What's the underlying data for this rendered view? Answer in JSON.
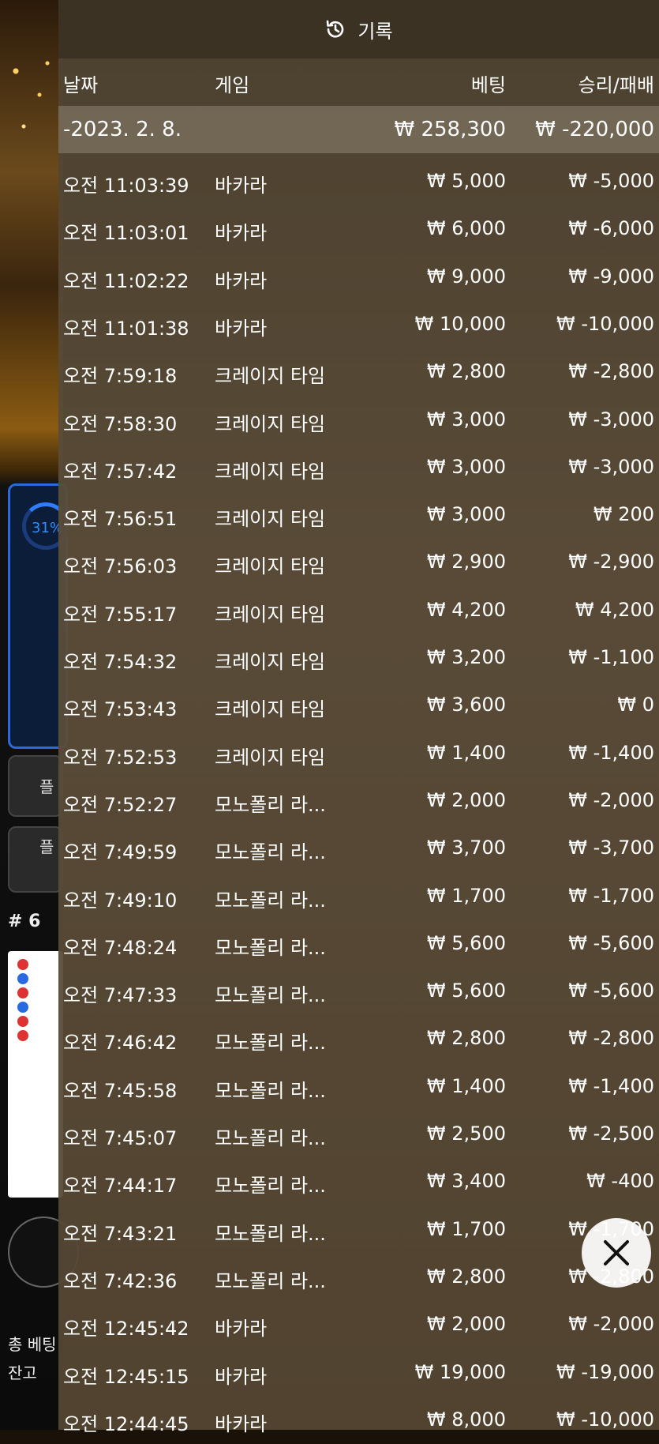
{
  "title": "기록",
  "columns": {
    "date": "날짜",
    "game": "게임",
    "bet": "베팅",
    "winloss": "승리/패배"
  },
  "date_group": {
    "date": "-2023. 2. 8.",
    "bet": "₩ 258,300",
    "winloss": "₩ -220,000"
  },
  "rows": [
    {
      "time": "오전 11:03:39",
      "game": "바카라",
      "bet": "₩ 5,000",
      "winloss": "₩ -5,000"
    },
    {
      "time": "오전 11:03:01",
      "game": "바카라",
      "bet": "₩ 6,000",
      "winloss": "₩ -6,000"
    },
    {
      "time": "오전 11:02:22",
      "game": "바카라",
      "bet": "₩ 9,000",
      "winloss": "₩ -9,000"
    },
    {
      "time": "오전 11:01:38",
      "game": "바카라",
      "bet": "₩ 10,000",
      "winloss": "₩ -10,000"
    },
    {
      "time": "오전 7:59:18",
      "game": "크레이지 타임",
      "bet": "₩ 2,800",
      "winloss": "₩ -2,800"
    },
    {
      "time": "오전 7:58:30",
      "game": "크레이지 타임",
      "bet": "₩ 3,000",
      "winloss": "₩ -3,000"
    },
    {
      "time": "오전 7:57:42",
      "game": "크레이지 타임",
      "bet": "₩ 3,000",
      "winloss": "₩ -3,000"
    },
    {
      "time": "오전 7:56:51",
      "game": "크레이지 타임",
      "bet": "₩ 3,000",
      "winloss": "₩ 200"
    },
    {
      "time": "오전 7:56:03",
      "game": "크레이지 타임",
      "bet": "₩ 2,900",
      "winloss": "₩ -2,900"
    },
    {
      "time": "오전 7:55:17",
      "game": "크레이지 타임",
      "bet": "₩ 4,200",
      "winloss": "₩ 4,200"
    },
    {
      "time": "오전 7:54:32",
      "game": "크레이지 타임",
      "bet": "₩ 3,200",
      "winloss": "₩ -1,100"
    },
    {
      "time": "오전 7:53:43",
      "game": "크레이지 타임",
      "bet": "₩ 3,600",
      "winloss": "₩ 0"
    },
    {
      "time": "오전 7:52:53",
      "game": "크레이지 타임",
      "bet": "₩ 1,400",
      "winloss": "₩ -1,400"
    },
    {
      "time": "오전 7:52:27",
      "game": "모노폴리 라...",
      "bet": "₩ 2,000",
      "winloss": "₩ -2,000"
    },
    {
      "time": "오전 7:49:59",
      "game": "모노폴리 라...",
      "bet": "₩ 3,700",
      "winloss": "₩ -3,700"
    },
    {
      "time": "오전 7:49:10",
      "game": "모노폴리 라...",
      "bet": "₩ 1,700",
      "winloss": "₩ -1,700"
    },
    {
      "time": "오전 7:48:24",
      "game": "모노폴리 라...",
      "bet": "₩ 5,600",
      "winloss": "₩ -5,600"
    },
    {
      "time": "오전 7:47:33",
      "game": "모노폴리 라...",
      "bet": "₩ 5,600",
      "winloss": "₩ -5,600"
    },
    {
      "time": "오전 7:46:42",
      "game": "모노폴리 라...",
      "bet": "₩ 2,800",
      "winloss": "₩ -2,800"
    },
    {
      "time": "오전 7:45:58",
      "game": "모노폴리 라...",
      "bet": "₩ 1,400",
      "winloss": "₩ -1,400"
    },
    {
      "time": "오전 7:45:07",
      "game": "모노폴리 라...",
      "bet": "₩ 2,500",
      "winloss": "₩ -2,500"
    },
    {
      "time": "오전 7:44:17",
      "game": "모노폴리 라...",
      "bet": "₩ 3,400",
      "winloss": "₩ -400"
    },
    {
      "time": "오전 7:43:21",
      "game": "모노폴리 라...",
      "bet": "₩ 1,700",
      "winloss": "₩ -1,700"
    },
    {
      "time": "오전 7:42:36",
      "game": "모노폴리 라...",
      "bet": "₩ 2,800",
      "winloss": "₩ -2,800"
    },
    {
      "time": "오전 12:45:42",
      "game": "바카라",
      "bet": "₩ 2,000",
      "winloss": "₩ -2,000"
    },
    {
      "time": "오전 12:45:15",
      "game": "바카라",
      "bet": "₩ 19,000",
      "winloss": "₩ -19,000"
    },
    {
      "time": "오전 12:44:45",
      "game": "바카라",
      "bet": "₩ 8,000",
      "winloss": "₩ -10,000"
    }
  ],
  "background": {
    "progress_text": "31%",
    "progress_value": 0.31,
    "button1_label": "플",
    "button2_label": "플",
    "round_label": "# 6",
    "total_bet_label": "총 베팅",
    "balance_label": "잔고"
  },
  "icons": {
    "title": "history-icon",
    "close": "close-icon",
    "chip": "chip-icon"
  },
  "colors": {
    "panel": "#54463a",
    "title_bar": "#3c3224",
    "date_row": "#786c5c",
    "close_bg": "#ffffff"
  }
}
